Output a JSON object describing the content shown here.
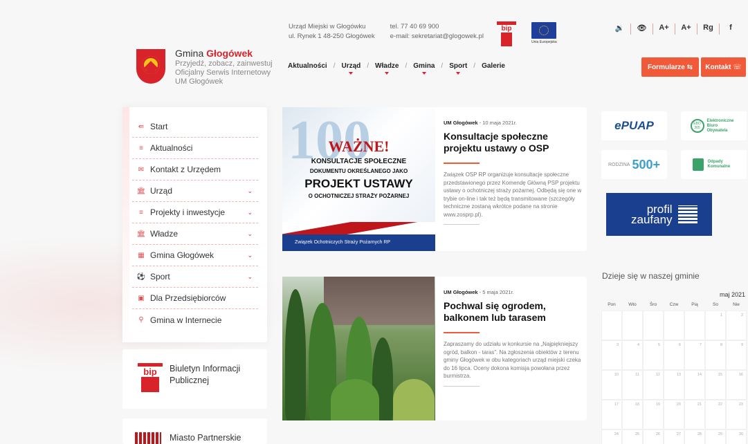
{
  "header": {
    "site_name_prefix": "Gmina",
    "site_name": "Głogówek",
    "tagline": "Przyjedź, zobacz, zainwestuj",
    "subtitle1": "Oficjalny Serwis Internetowy",
    "subtitle2": "UM Głogówek",
    "address1": "Urząd Miejski w Głogówku",
    "address2": "ul. Rynek 1 48-250 Głogówek",
    "phone": "tel. 77 40 69 900",
    "email": "e-mail: sekretariat@glogowek.pl",
    "bip_label": "bip",
    "eu_label": "Unia Europejska",
    "tools": [
      "🔉",
      "👁",
      "A+",
      "A+",
      "Rg",
      "f"
    ]
  },
  "nav": {
    "items": [
      {
        "label": "Aktualności",
        "dropdown": false
      },
      {
        "label": "Urząd",
        "dropdown": true
      },
      {
        "label": "Władze",
        "dropdown": true
      },
      {
        "label": "Gmina",
        "dropdown": true
      },
      {
        "label": "Sport",
        "dropdown": true
      },
      {
        "label": "Galerie",
        "dropdown": false
      }
    ],
    "btn_forms": "Formularze ⇆",
    "btn_contact": "Kontakt ☏"
  },
  "sidebar": {
    "items": [
      {
        "label": "Start",
        "icon": "⇚"
      },
      {
        "label": "Aktualności",
        "icon": "≡"
      },
      {
        "label": "Kontakt z Urzędem",
        "icon": "✉"
      },
      {
        "label": "Urząd",
        "icon": "🏛",
        "chev": "⌄"
      },
      {
        "label": "Projekty i inwestycje",
        "icon": "≡",
        "chev": "⌄"
      },
      {
        "label": "Władze",
        "icon": "🏛",
        "chev": "⌄"
      },
      {
        "label": "Gmina Głogówek",
        "icon": "▦",
        "chev": "⌄"
      },
      {
        "label": "Sport",
        "icon": "⚽",
        "chev": "⌄"
      },
      {
        "label": "Dla Przedsiębiorców",
        "icon": "▣"
      },
      {
        "label": "Gmina w Internecie",
        "icon": "⚲"
      }
    ],
    "bip_box": {
      "label1": "Biuletyn Informacji",
      "label2": "Publicznej",
      "logo": "bip"
    },
    "partner_box": {
      "label": "Miasto Partnerskie"
    }
  },
  "articles": [
    {
      "author": "UM Głogówek",
      "date": " - 10 maja 2021r.",
      "title": "Konsultacje społeczne projektu ustawy o OSP",
      "text": "Związek OSP RP organizuje konsultacje społeczne przedstawionego przez Komendę Główną PSP projektu ustawy o ochotniczej straży pożarnej. Odbędą się one w trybie on-line i tak też będą transmitowane (szczegóły techniczne zostaną wkrótce podane na stronie www.zosprp.pl).",
      "img": {
        "big": "100",
        "warn": "WAŻNE!",
        "l1": "KONSULTACJE SPOŁECZNE",
        "l2": "DOKUMENTU OKREŚLANEGO JAKO",
        "l3": "PROJEKT USTAWY",
        "l4": "O OCHOTNICZEJ STRAŻY POŻARNEJ",
        "footer": "Związek Ochotniczych Straży Pożarnych RP"
      }
    },
    {
      "author": "UM Głogówek",
      "date": " - 5 maja 2021r.",
      "title": "Pochwal się ogrodem, balkonem lub tarasem",
      "text": "Zapraszamy do udziału w konkursie na „Najpiękniejszy ogród, balkon - taras”. Na zgłoszenia obiektów z terenu gminy Głogówek w obu kategoriach urząd miejski czeka do 16 lipca. Oceny dokona komisja powołana przez burmistrza."
    }
  ],
  "right": {
    "epuap": "ePUAP",
    "ebo": "Elektroniczne Biuro Obywatela",
    "ebo_badge": "EBO 365",
    "program": "500+",
    "program_small": "RODZINA",
    "odpady": "Odpady Komunalne",
    "profil1": "profil",
    "profil2": "zaufany",
    "events_title": "Dzieje się w naszej gminie",
    "month": "maj 2021",
    "days": [
      "Pon",
      "Wto",
      "Śro",
      "Czw",
      "Pią",
      "So",
      "Nie"
    ],
    "cells": [
      "",
      "",
      "",
      "",
      "",
      "1",
      "2",
      "3",
      "4",
      "5",
      "6",
      "7",
      "8",
      "9",
      "10",
      "11",
      "12",
      "13",
      "14",
      "15",
      "16",
      "17",
      "18",
      "19",
      "20",
      "21",
      "22",
      "23",
      "24",
      "25",
      "26",
      "27",
      "28",
      "29",
      "30"
    ]
  }
}
